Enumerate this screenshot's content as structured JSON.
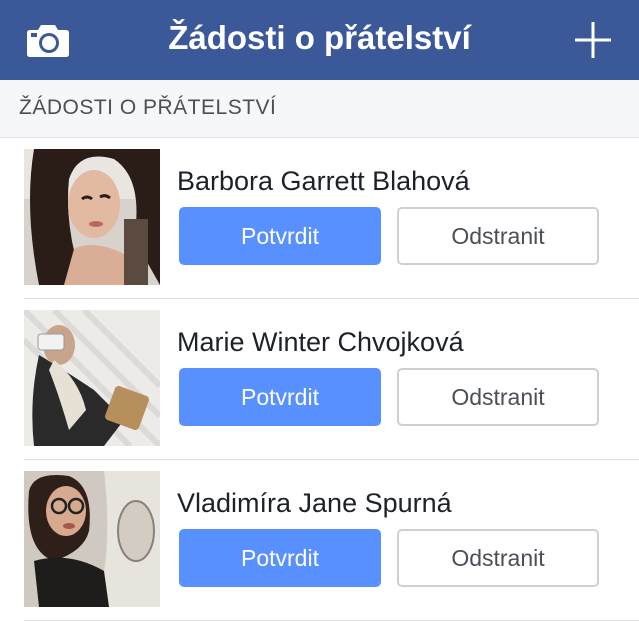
{
  "header": {
    "title": "Žádosti o přátelství",
    "left_icon": "camera-icon",
    "right_icon": "plus-icon",
    "bg_color": "#3b5998"
  },
  "section": {
    "title": "ŽÁDOSTI O PŘÁTELSTVÍ"
  },
  "requests": [
    {
      "name": "Barbora Garrett Blahová",
      "confirm_label": "Potvrdit",
      "delete_label": "Odstranit"
    },
    {
      "name": "Marie Winter Chvojková",
      "confirm_label": "Potvrdit",
      "delete_label": "Odstranit"
    },
    {
      "name": "Vladimíra Jane Spurná",
      "confirm_label": "Potvrdit",
      "delete_label": "Odstranit"
    }
  ],
  "colors": {
    "confirm_button": "#5890ff",
    "delete_button_border": "#ccd0d5"
  }
}
